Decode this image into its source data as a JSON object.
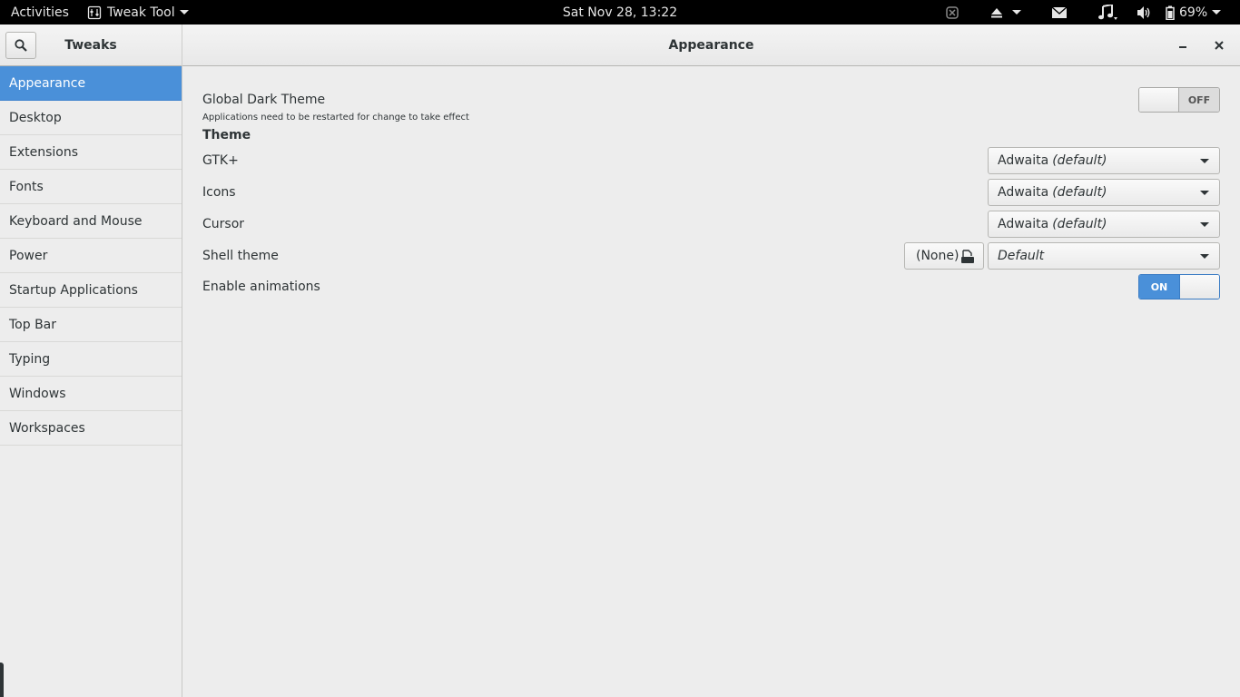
{
  "topbar": {
    "activities": "Activities",
    "app_menu": "Tweak Tool",
    "clock": "Sat Nov 28, 13:22",
    "battery": "69%"
  },
  "header": {
    "sidebar_title": "Tweaks",
    "page_title": "Appearance"
  },
  "sidebar": {
    "items": [
      {
        "label": "Appearance"
      },
      {
        "label": "Desktop"
      },
      {
        "label": "Extensions"
      },
      {
        "label": "Fonts"
      },
      {
        "label": "Keyboard and Mouse"
      },
      {
        "label": "Power"
      },
      {
        "label": "Startup Applications"
      },
      {
        "label": "Top Bar"
      },
      {
        "label": "Typing"
      },
      {
        "label": "Windows"
      },
      {
        "label": "Workspaces"
      }
    ],
    "selected_index": 0
  },
  "content": {
    "dark_theme_label": "Global Dark Theme",
    "dark_theme_hint": "Applications need to be restarted for change to take effect",
    "dark_theme_state": "OFF",
    "theme_section": "Theme",
    "gtk_label": "GTK+",
    "gtk_value": "Adwaita",
    "gtk_value_suffix": "(default)",
    "icons_label": "Icons",
    "icons_value": "Adwaita",
    "icons_value_suffix": "(default)",
    "cursor_label": "Cursor",
    "cursor_value": "Adwaita",
    "cursor_value_suffix": "(default)",
    "shell_label": "Shell theme",
    "shell_file": "(None)",
    "shell_value": "Default",
    "animations_label": "Enable animations",
    "animations_state": "ON"
  },
  "colors": {
    "accent": "#4a90d9",
    "topbar_bg": "#000000",
    "window_bg": "#ededed"
  }
}
